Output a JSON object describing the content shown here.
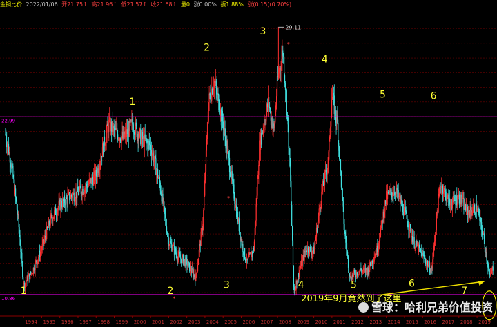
{
  "header": {
    "name": "金铜比价",
    "date": "2022/01/06",
    "open": "开21.75↑",
    "high": "高21.96↑",
    "low": "低21.57↑",
    "close": "收21.68↑",
    "volume": "量0",
    "change": "涨0.00%",
    "amplitude": "振1.88%",
    "change_value": "涨(0.15)(0.70%)"
  },
  "colors": {
    "background": "#000000",
    "grid": "#6b0000",
    "up_candle": "#ff3030",
    "down_candle": "#40e0e0",
    "hline": "#ff00ff",
    "label_yellow": "#ffff33",
    "header_yellow": "#ffff00"
  },
  "watermark": "雪球：哈利兄弟价值投资",
  "chart_data": {
    "type": "candlestick",
    "x": [
      1993.0,
      1993.3,
      1993.7,
      1994.0,
      1994.5,
      1995.0,
      1995.5,
      1996.0,
      1996.5,
      1997.0,
      1997.5,
      1998.0,
      1998.3,
      1998.7,
      1999.0,
      1999.5,
      2000.0,
      2000.5,
      2001.0,
      2001.5,
      2002.0,
      2002.5,
      2003.0,
      2003.5,
      2003.9,
      2004.2,
      2004.5,
      2005.0,
      2005.5,
      2006.0,
      2006.3,
      2006.7,
      2007.0,
      2007.5,
      2007.8,
      2008.0,
      2008.3,
      2008.5,
      2008.7,
      2008.9,
      2009.2,
      2009.6,
      2010.0,
      2010.4,
      2010.8,
      2011.0,
      2011.3,
      2011.7,
      2012.0,
      2012.5,
      2013.0,
      2013.5,
      2014.0,
      2014.5,
      2015.0,
      2015.5,
      2016.0,
      2016.5,
      2016.8,
      2017.0,
      2017.5,
      2018.0,
      2018.5,
      2019.0,
      2019.4,
      2019.7,
      2019.9
    ],
    "y": [
      21.8,
      20.0,
      16.0,
      11.5,
      12.5,
      14.0,
      16.0,
      17.0,
      17.5,
      17.8,
      18.3,
      19.0,
      20.5,
      22.5,
      22.0,
      21.5,
      22.5,
      21.5,
      21.0,
      18.5,
      14.5,
      13.5,
      13.0,
      12.0,
      16.0,
      24.0,
      25.5,
      22.5,
      18.5,
      14.5,
      13.0,
      14.0,
      21.0,
      24.0,
      22.0,
      25.5,
      27.5,
      24.0,
      19.0,
      11.0,
      12.5,
      14.0,
      13.8,
      17.5,
      20.0,
      24.5,
      22.5,
      15.0,
      12.0,
      12.5,
      12.5,
      14.0,
      17.5,
      18.0,
      16.5,
      14.5,
      13.5,
      12.5,
      16.5,
      18.5,
      17.0,
      17.5,
      16.5,
      16.8,
      14.5,
      12.0,
      12.8
    ],
    "hlines": [
      22.99,
      10.86
    ],
    "max_label": "29.11",
    "left_labels": [
      "22.99",
      "10.86"
    ],
    "year_ticks": [
      "1994",
      "1995",
      "1996",
      "1997",
      "1998",
      "1999",
      "2000",
      "2001",
      "2002",
      "2003",
      "2004",
      "2005",
      "2006",
      "2007",
      "2008",
      "2009",
      "2010",
      "2011",
      "2012",
      "2013",
      "2014",
      "2015",
      "2016",
      "2017",
      "2018",
      "2019"
    ],
    "wave_labels": [
      {
        "text": "1",
        "x": 1994.0,
        "y": 10.9
      },
      {
        "text": "1",
        "x": 2000.0,
        "y": 23.8
      },
      {
        "text": "2",
        "x": 2002.1,
        "y": 10.9
      },
      {
        "text": "2",
        "x": 2004.1,
        "y": 27.5
      },
      {
        "text": "3",
        "x": 2005.2,
        "y": 11.3
      },
      {
        "text": "3",
        "x": 2007.2,
        "y": 28.6
      },
      {
        "text": "4",
        "x": 2009.3,
        "y": 11.3
      },
      {
        "text": "4",
        "x": 2010.6,
        "y": 26.7
      },
      {
        "text": "5",
        "x": 2012.2,
        "y": 11.3
      },
      {
        "text": "5",
        "x": 2013.8,
        "y": 24.3
      },
      {
        "text": "6",
        "x": 2015.4,
        "y": 11.4
      },
      {
        "text": "6",
        "x": 2016.6,
        "y": 24.2
      },
      {
        "text": "7",
        "x": 2018.3,
        "y": 10.9
      }
    ],
    "annotation": "2019年9月竟然到了这里",
    "xlim": [
      1992.7,
      2020.1
    ],
    "ylim": [
      9.4,
      30.3
    ]
  }
}
